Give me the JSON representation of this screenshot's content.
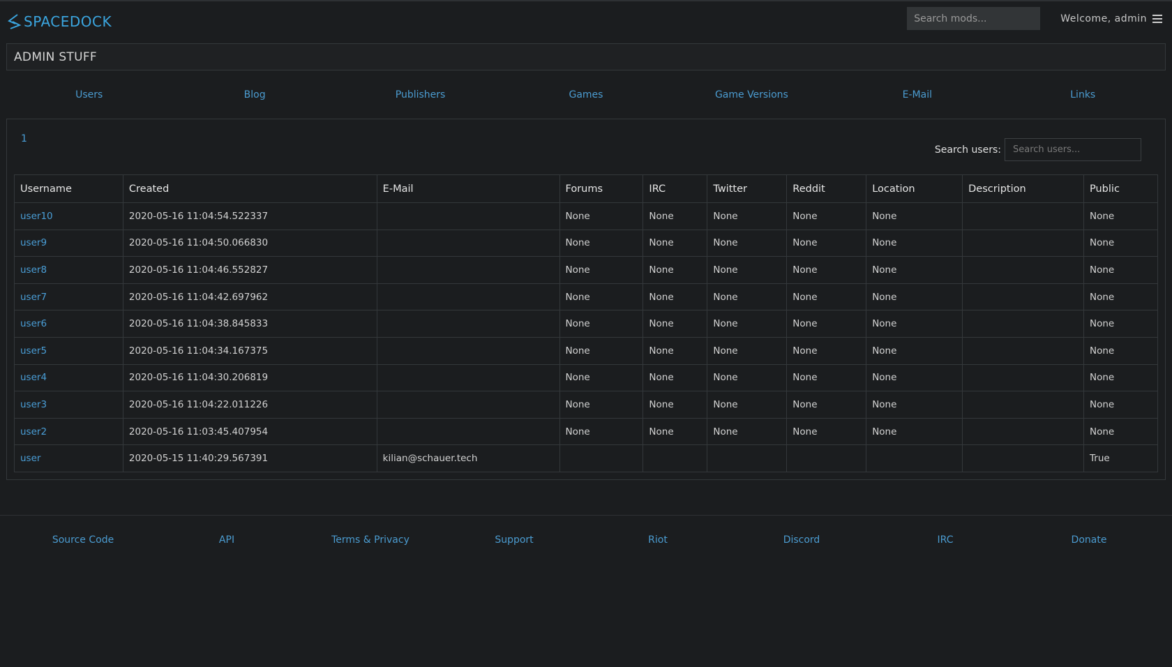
{
  "header": {
    "logo_text": "SPACEDOCK",
    "search_placeholder": "Search mods...",
    "welcome": "Welcome, admin"
  },
  "admin": {
    "title": "ADMIN STUFF",
    "nav": [
      "Users",
      "Blog",
      "Publishers",
      "Games",
      "Game Versions",
      "E-Mail",
      "Links"
    ]
  },
  "users": {
    "page": "1",
    "search_label": "Search users:",
    "search_placeholder": "Search users...",
    "columns": [
      "Username",
      "Created",
      "E-Mail",
      "Forums",
      "IRC",
      "Twitter",
      "Reddit",
      "Location",
      "Description",
      "Public"
    ],
    "rows": [
      [
        "user10",
        "2020-05-16 11:04:54.522337",
        "",
        "None",
        "None",
        "None",
        "None",
        "None",
        "",
        "None"
      ],
      [
        "user9",
        "2020-05-16 11:04:50.066830",
        "",
        "None",
        "None",
        "None",
        "None",
        "None",
        "",
        "None"
      ],
      [
        "user8",
        "2020-05-16 11:04:46.552827",
        "",
        "None",
        "None",
        "None",
        "None",
        "None",
        "",
        "None"
      ],
      [
        "user7",
        "2020-05-16 11:04:42.697962",
        "",
        "None",
        "None",
        "None",
        "None",
        "None",
        "",
        "None"
      ],
      [
        "user6",
        "2020-05-16 11:04:38.845833",
        "",
        "None",
        "None",
        "None",
        "None",
        "None",
        "",
        "None"
      ],
      [
        "user5",
        "2020-05-16 11:04:34.167375",
        "",
        "None",
        "None",
        "None",
        "None",
        "None",
        "",
        "None"
      ],
      [
        "user4",
        "2020-05-16 11:04:30.206819",
        "",
        "None",
        "None",
        "None",
        "None",
        "None",
        "",
        "None"
      ],
      [
        "user3",
        "2020-05-16 11:04:22.011226",
        "",
        "None",
        "None",
        "None",
        "None",
        "None",
        "",
        "None"
      ],
      [
        "user2",
        "2020-05-16 11:03:45.407954",
        "",
        "None",
        "None",
        "None",
        "None",
        "None",
        "",
        "None"
      ],
      [
        "user",
        "2020-05-15 11:40:29.567391",
        "kilian@schauer.tech",
        "",
        "",
        "",
        "",
        "",
        "",
        "True"
      ]
    ]
  },
  "footer": {
    "links": [
      "Source Code",
      "API",
      "Terms & Privacy",
      "Support",
      "Riot",
      "Discord",
      "IRC",
      "Donate"
    ]
  },
  "colors": {
    "background": "#1b1d1f",
    "accent": "#4a9fd8",
    "border": "#34383b"
  }
}
